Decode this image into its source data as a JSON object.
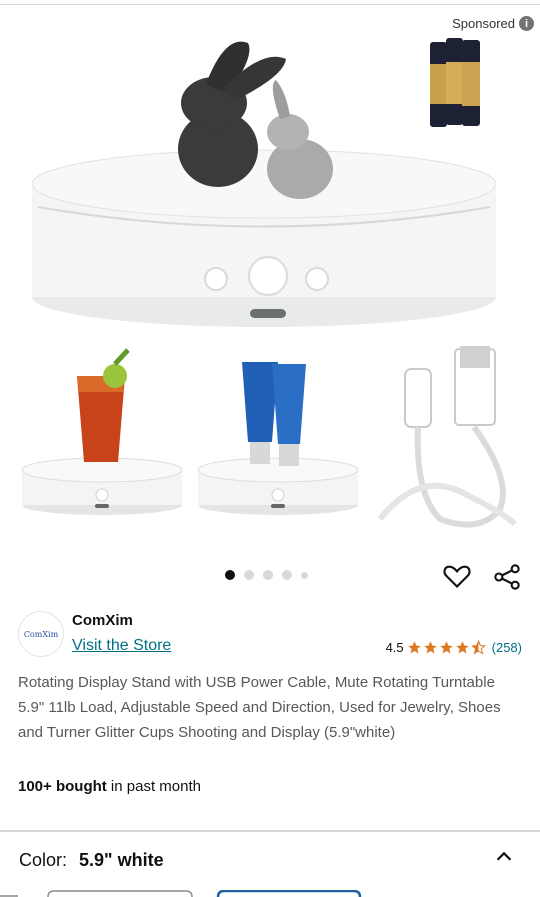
{
  "sponsored": {
    "label": "Sponsored"
  },
  "gallery": {
    "dots": 5,
    "active_index": 0
  },
  "brand": {
    "name": "ComXim",
    "logo_text": "ComXim",
    "visit_store": "Visit the Store"
  },
  "rating": {
    "value": "4.5",
    "stars": 4.5,
    "count": "(258)"
  },
  "product": {
    "title": "Rotating Display Stand with USB Power Cable, Mute Rotating Turntable 5.9\" 11lb Load, Adjustable Speed and Direction, Used for Jewelry, Shoes and Turner Glitter Cups Shooting and Display (5.9\"white)",
    "bought_bold": "100+ bought",
    "bought_rest": " in past month"
  },
  "variation": {
    "label": "Color:",
    "value": "5.9\" white"
  },
  "colors": {
    "link": "#007185",
    "star": "#de7921"
  }
}
